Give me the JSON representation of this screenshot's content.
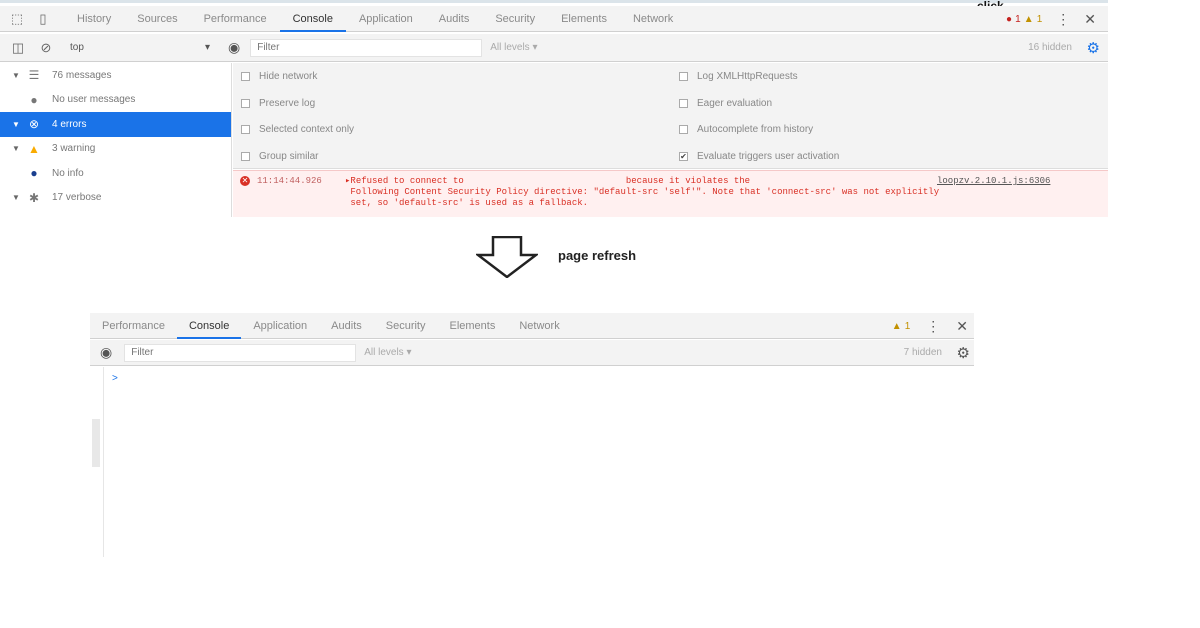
{
  "top_panel": {
    "tabs": [
      "History",
      "Sources",
      "Performance",
      "Console",
      "Application",
      "Audits",
      "Security",
      "Elements",
      "Network"
    ],
    "active_tab": "Console",
    "click_label": "click",
    "error_count": "1",
    "warning_count": "1",
    "context_select": "top",
    "filter_placeholder": "Filter",
    "levels_label": "All levels ▾",
    "hidden_count": "16 hidden",
    "sidebar": [
      {
        "label": "76 messages",
        "icon": "list-icon",
        "arrow": true
      },
      {
        "label": "No user messages",
        "icon": "user-icon",
        "arrow": false
      },
      {
        "label": "4 errors",
        "icon": "error-icon",
        "arrow": true,
        "selected": true
      },
      {
        "label": "3 warning",
        "icon": "warning-icon",
        "arrow": true
      },
      {
        "label": "No info",
        "icon": "info-icon",
        "arrow": false
      },
      {
        "label": "17 verbose",
        "icon": "bug-icon",
        "arrow": true
      }
    ],
    "settings_left": [
      "Hide network",
      "Preserve log",
      "Selected context only",
      "Group similar"
    ],
    "settings_right": [
      "Log XMLHttpRequests",
      "Eager evaluation",
      "Autocomplete from history",
      "Evaluate triggers user activation"
    ],
    "settings_right_checked": [
      false,
      false,
      false,
      true
    ],
    "error_row": {
      "time": "11:14:44.926",
      "text": "▸Refused to connect to                              because it violates the\n Following Content Security Policy directive: \"default-src 'self'\". Note that 'connect-src' was not explicitly\n set, so 'default-src' is used as a fallback.",
      "source": "loopzv.2.10.1.js:6306"
    }
  },
  "arrow_label": "page refresh",
  "bottom_panel": {
    "tabs": [
      "Performance",
      "Console",
      "Application",
      "Audits",
      "Security",
      "Elements",
      "Network"
    ],
    "active_tab": "Console",
    "warning_count": "1",
    "filter_placeholder": "Filter",
    "levels_label": "All levels ▾",
    "hidden_count": "7 hidden",
    "prompt": ">"
  },
  "colors": {
    "accent": "#1a73e8",
    "error": "#d93025",
    "error_bg": "#fff0f0",
    "warning": "#f9ab00"
  }
}
